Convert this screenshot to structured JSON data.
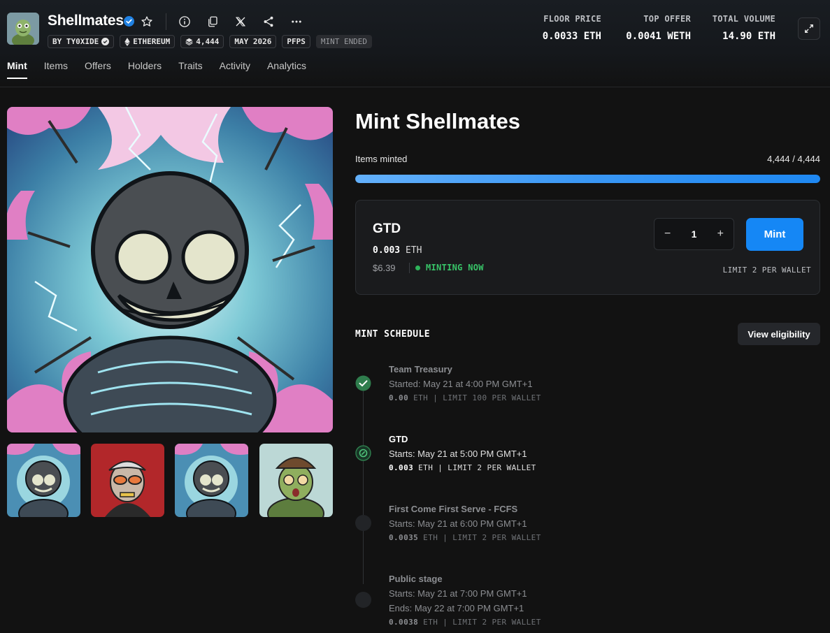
{
  "header": {
    "title": "Shellmates",
    "chips": {
      "creator": "BY TY0XIDE",
      "chain": "ETHEREUM",
      "supply": "4,444",
      "date": "MAY 2026",
      "category": "PFPS",
      "status": "MINT ENDED"
    },
    "stats": {
      "floor_label": "FLOOR PRICE",
      "floor_value": "0.0033 ETH",
      "offer_label": "TOP OFFER",
      "offer_value": "0.0041 WETH",
      "volume_label": "TOTAL VOLUME",
      "volume_value": "14.90 ETH"
    }
  },
  "tabs": [
    "Mint",
    "Items",
    "Offers",
    "Holders",
    "Traits",
    "Activity",
    "Analytics"
  ],
  "mint": {
    "title": "Mint Shellmates",
    "items_minted_label": "Items minted",
    "items_minted_value": "4,444 / 4,444",
    "progress_fraction": 1.0,
    "stage": {
      "name": "GTD",
      "price_amount": "0.003",
      "price_unit": "ETH",
      "usd": "$6.39",
      "status": "MINTING NOW",
      "quantity": "1",
      "mint_label": "Mint",
      "limit": "LIMIT 2 PER WALLET"
    }
  },
  "schedule": {
    "title": "MINT SCHEDULE",
    "eligibility_label": "View eligibility",
    "stages": [
      {
        "name": "Team Treasury",
        "line1": "Started: May 21 at 4:00 PM GMT+1",
        "line2": "",
        "price": "0.00",
        "meta": "ETH | LIMIT 100 PER WALLET"
      },
      {
        "name": "GTD",
        "line1": "Starts: May 21 at 5:00 PM GMT+1",
        "line2": "",
        "price": "0.003",
        "meta": "ETH | LIMIT 2 PER WALLET"
      },
      {
        "name": "First Come First Serve - FCFS",
        "line1": "Starts: May 21 at 6:00 PM GMT+1",
        "line2": "",
        "price": "0.0035",
        "meta": "ETH | LIMIT 2 PER WALLET"
      },
      {
        "name": "Public stage",
        "line1": "Starts: May 21 at 7:00 PM GMT+1",
        "line2": "Ends: May 22 at 7:00 PM GMT+1",
        "price": "0.0038",
        "meta": "ETH | LIMIT 2 PER WALLET"
      }
    ]
  },
  "colors": {
    "accent": "#1587f5",
    "live": "#38c468",
    "background": "#121212"
  }
}
